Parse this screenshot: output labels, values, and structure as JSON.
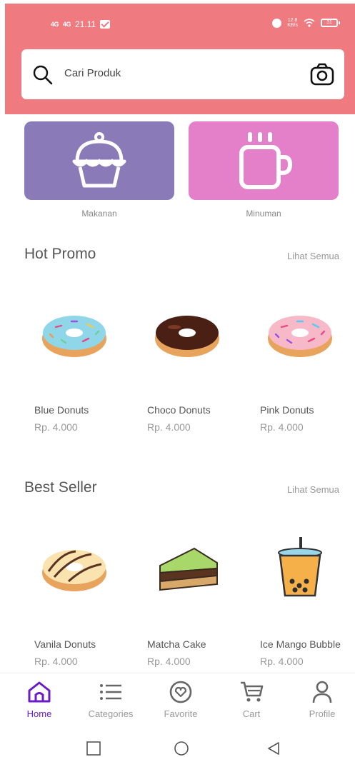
{
  "status_bar": {
    "signal1": "4G",
    "signal2": "4G",
    "time": "21.11",
    "speed_value": "12.8",
    "speed_unit": "KB/s",
    "battery": "31"
  },
  "search": {
    "placeholder": "Cari Produk",
    "search_icon": "magnifier-icon",
    "camera_icon": "camera-icon"
  },
  "categories": [
    {
      "label": "Makanan",
      "icon": "cupcake-icon",
      "color": "#8b7ab8"
    },
    {
      "label": "Minuman",
      "icon": "mug-icon",
      "color": "#e480c9"
    }
  ],
  "hot_promo": {
    "title": "Hot Promo",
    "see_all": "Lihat Semua",
    "items": [
      {
        "name": "Blue Donuts",
        "price": "Rp. 4.000",
        "icon": "blue-donut-icon"
      },
      {
        "name": "Choco Donuts",
        "price": "Rp. 4.000",
        "icon": "choco-donut-icon"
      },
      {
        "name": "Pink Donuts",
        "price": "Rp. 4.000",
        "icon": "pink-donut-icon"
      }
    ]
  },
  "best_seller": {
    "title": "Best Seller",
    "see_all": "Lihat Semua",
    "items": [
      {
        "name": "Vanila Donuts",
        "price": "Rp. 4.000",
        "icon": "vanilla-donut-icon"
      },
      {
        "name": "Matcha Cake",
        "price": "Rp. 4.000",
        "icon": "matcha-cake-icon"
      },
      {
        "name": "Ice Mango Bubble",
        "price": "Rp. 4.000",
        "icon": "bubble-tea-icon"
      }
    ]
  },
  "bottom_nav": [
    {
      "label": "Home",
      "icon": "home-icon",
      "active": true
    },
    {
      "label": "Categories",
      "icon": "list-icon",
      "active": false
    },
    {
      "label": "Favorite",
      "icon": "heart-icon",
      "active": false
    },
    {
      "label": "Cart",
      "icon": "cart-icon",
      "active": false
    },
    {
      "label": "Profile",
      "icon": "person-icon",
      "active": false
    }
  ],
  "colors": {
    "header": "#ef7b80",
    "active_nav": "#6a1cc7",
    "food_tile": "#8b7ab8",
    "drink_tile": "#e480c9"
  }
}
